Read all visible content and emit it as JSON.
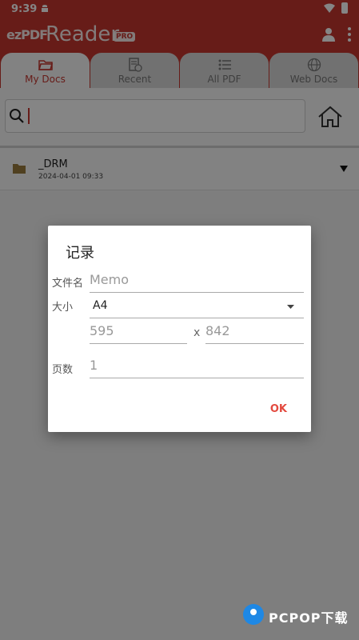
{
  "status_bar": {
    "time": "9:39"
  },
  "app_bar": {
    "logo_ez": "ezPDF",
    "logo_reader": "Reader",
    "logo_pro": "PRO"
  },
  "tabs": [
    {
      "label": "My Docs",
      "icon": "folder-open-icon",
      "active": true
    },
    {
      "label": "Recent",
      "icon": "recent-doc-icon",
      "active": false
    },
    {
      "label": "All PDF",
      "icon": "list-icon",
      "active": false
    },
    {
      "label": "Web Docs",
      "icon": "globe-icon",
      "active": false
    }
  ],
  "search": {
    "value": "",
    "placeholder": ""
  },
  "file_list": [
    {
      "name": "_DRM",
      "date": "2024-04-01 09:33",
      "icon": "folder-icon"
    }
  ],
  "dialog": {
    "title": "记录",
    "file_name_label": "文件名",
    "file_name_placeholder": "Memo",
    "size_label": "大小",
    "size_value": "A4",
    "width_placeholder": "595",
    "separator": "x",
    "height_placeholder": "842",
    "pages_label": "页数",
    "pages_placeholder": "1",
    "ok_label": "OK"
  },
  "watermark": {
    "text": "PCPOP下载"
  },
  "colors": {
    "accent": "#c5362f",
    "ok": "#e34a3f",
    "scrim": "rgba(0,0,0,0.48)"
  }
}
